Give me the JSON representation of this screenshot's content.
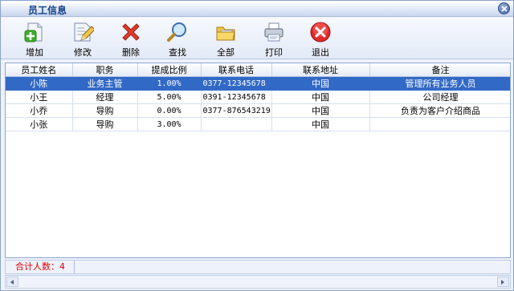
{
  "window": {
    "title": "员工信息"
  },
  "toolbar": {
    "buttons": [
      {
        "label": "增加",
        "icon": "add-document-icon"
      },
      {
        "label": "修改",
        "icon": "edit-document-icon"
      },
      {
        "label": "删除",
        "icon": "red-x-icon"
      },
      {
        "label": "查找",
        "icon": "magnifier-icon"
      },
      {
        "label": "全部",
        "icon": "folder-icon"
      },
      {
        "label": "打印",
        "icon": "printer-icon"
      },
      {
        "label": "退出",
        "icon": "exit-icon"
      }
    ]
  },
  "grid": {
    "columns": [
      "员工姓名",
      "职务",
      "提成比例",
      "联系电话",
      "联系地址",
      "备注"
    ],
    "rows": [
      [
        "小陈",
        "业务主管",
        "1.00%",
        "0377-12345678",
        "中国",
        "管理所有业务人员"
      ],
      [
        "小王",
        "经理",
        "5.00%",
        "0391-12345678",
        "中国",
        "公司经理"
      ],
      [
        "小乔",
        "导购",
        "0.00%",
        "0377-876543219",
        "中国",
        "负责为客户介绍商品"
      ],
      [
        "小张",
        "导购",
        "3.00%",
        "",
        "中国",
        ""
      ]
    ],
    "selected_row": 0
  },
  "status": {
    "total_label": "合计人数：4"
  },
  "colors": {
    "selection": "#3169c6",
    "title_text": "#15428b",
    "status_text": "#e00000"
  }
}
